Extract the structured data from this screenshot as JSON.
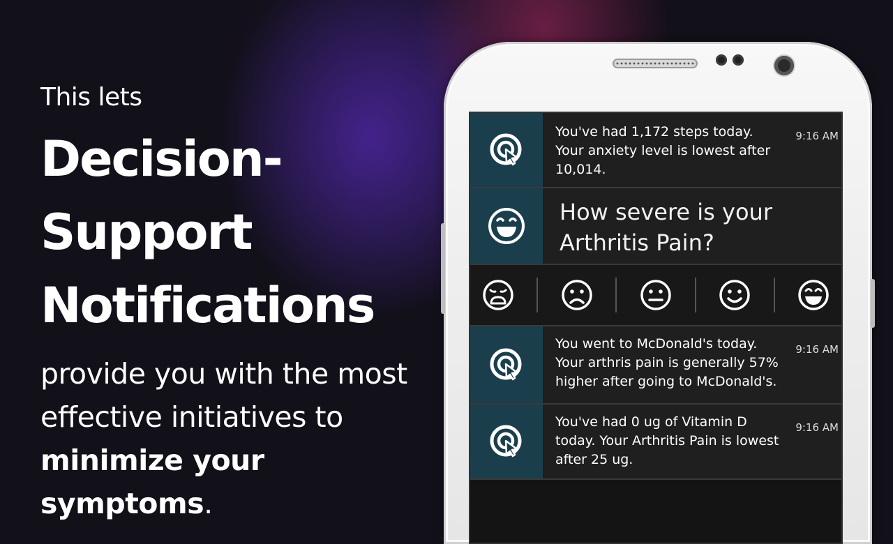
{
  "pitch": {
    "intro": "This lets",
    "headline_lines": [
      "Decision-",
      "Support",
      "Notifications"
    ],
    "body_plain": "provide you with the most effective initiatives to ",
    "body_bold": "minimize your symptoms",
    "body_end": "."
  },
  "notifications": [
    {
      "message": "You've had 1,172 steps today. Your anxiety level is lowest after 10,014.",
      "time": "9:16 AM",
      "icon": "target-cursor-icon"
    },
    {
      "message": "How severe is your Arthritis Pain?",
      "icon": "smiley-icon"
    },
    {
      "message": "You went to McDonald's today. Your arthris pain is generally 57% higher after going to McDonald's.",
      "time": "9:16 AM",
      "icon": "target-cursor-icon"
    },
    {
      "message": "You've had 0 ug of Vitamin D today.  Your Arthritis Pain is lowest after 25 ug.",
      "time": "9:16 AM",
      "icon": "target-cursor-icon"
    }
  ],
  "rating_options": [
    "very-sad-face-icon",
    "sad-face-icon",
    "neutral-face-icon",
    "smile-face-icon",
    "grin-face-icon"
  ],
  "colors": {
    "icon_tile": "#1b3e4d",
    "notification_bg": "#1f1f1f",
    "page_bg": "#121019",
    "glow_purple": "#5028aa",
    "glow_magenta": "#aa285a"
  }
}
